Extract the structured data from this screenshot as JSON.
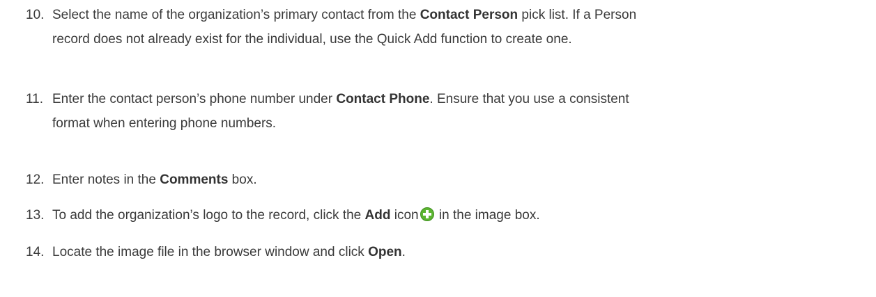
{
  "steps": [
    {
      "number": "10.",
      "lines": [
        {
          "a": "Select the name of the organization’s primary contact from the ",
          "b": "Contact Person",
          "c": " pick list. If a Person"
        },
        {
          "a": "record does not already exist for the individual, use the Quick Add function to create one."
        }
      ]
    },
    {
      "number": "11.",
      "lines": [
        {
          "a": "Enter the contact person’s phone number under ",
          "b": "Contact Phone",
          "c": ". Ensure that you use a consistent"
        },
        {
          "a": "format when entering phone numbers."
        }
      ]
    },
    {
      "number": "12.",
      "lines": [
        {
          "a": "Enter notes in the ",
          "b": "Comments",
          "c": " box."
        }
      ]
    },
    {
      "number": "13.",
      "lines": [
        {
          "a": "To add the organization’s logo to the record, click the ",
          "b": "Add",
          "c": " icon",
          "d": " in the image box."
        }
      ]
    },
    {
      "number": "14.",
      "lines": [
        {
          "a": "Locate the image file in the browser window and click ",
          "b": "Open",
          "c": "."
        }
      ]
    }
  ],
  "icons": {
    "add": "plus-circle-icon",
    "add_color": "#5cb531"
  }
}
